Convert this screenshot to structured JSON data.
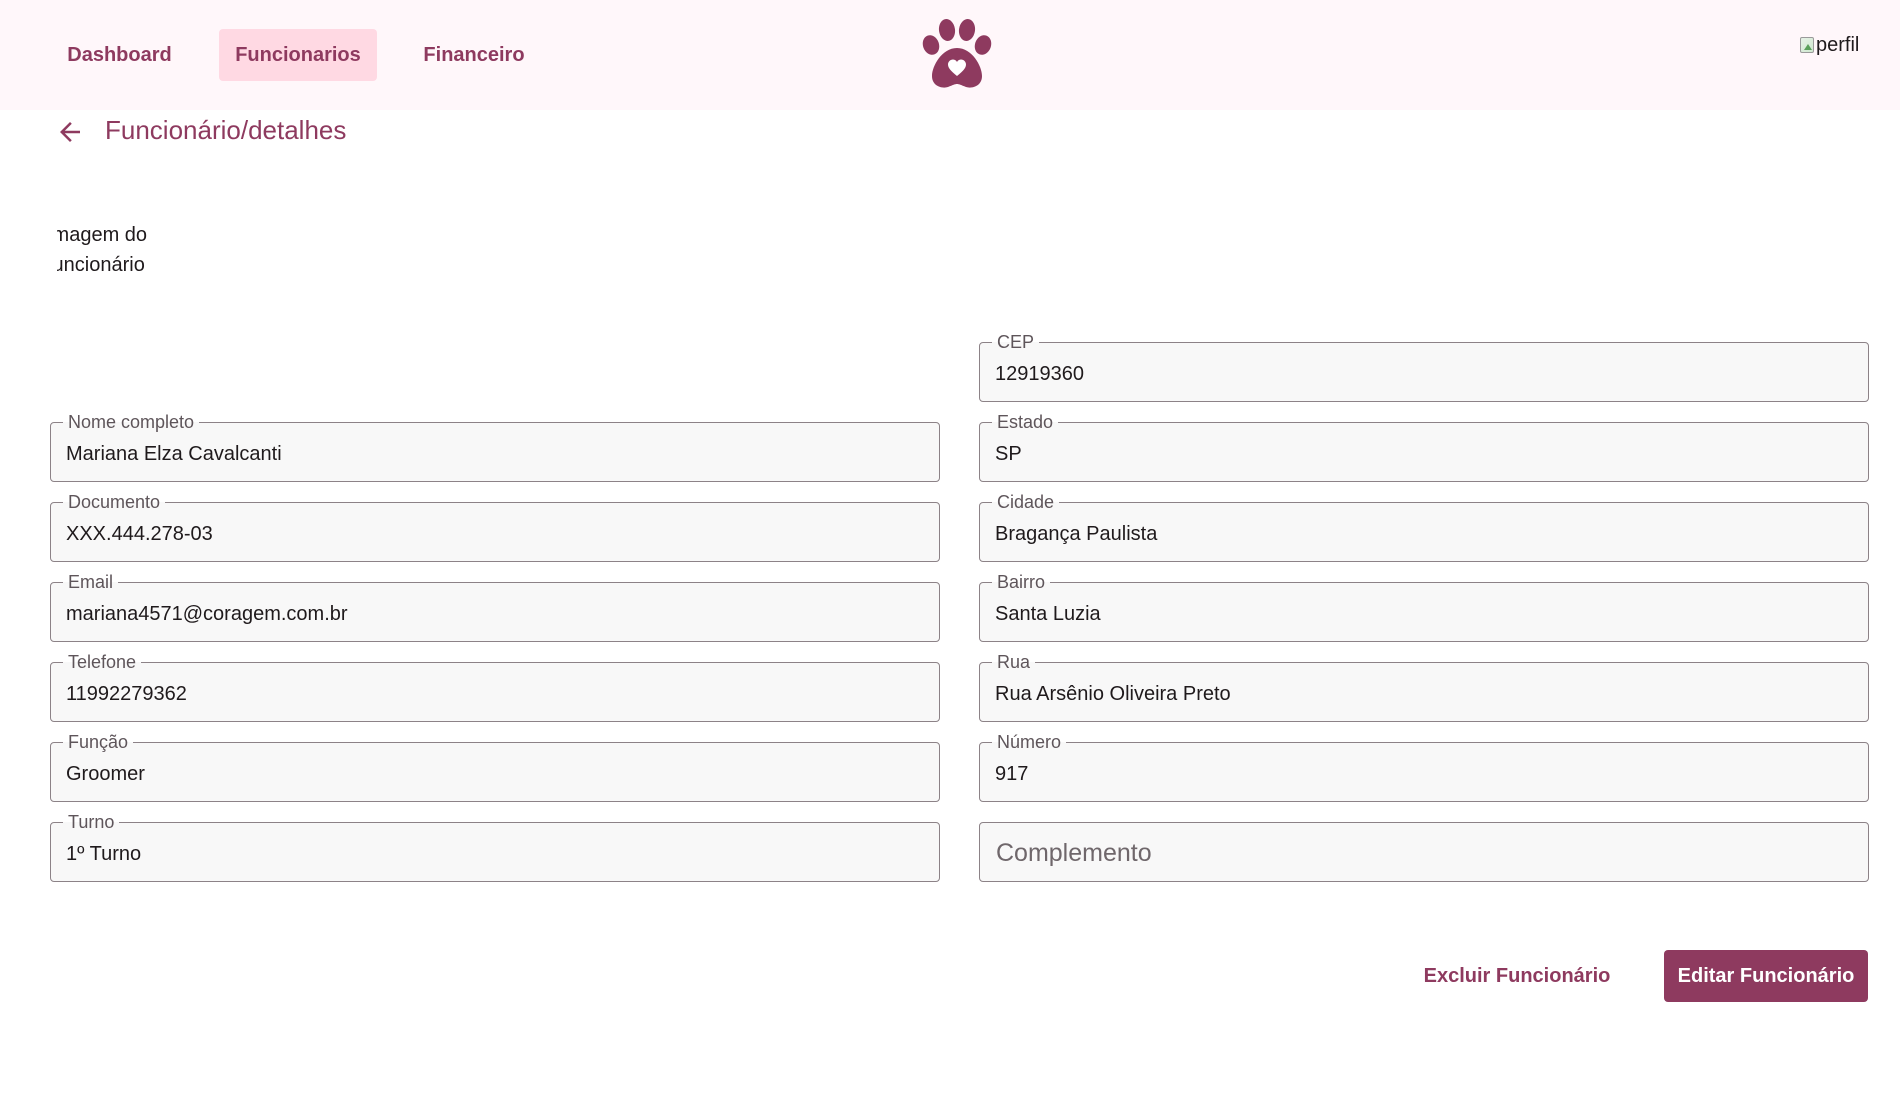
{
  "nav": {
    "items": [
      {
        "label": "Dashboard"
      },
      {
        "label": "Funcionarios"
      },
      {
        "label": "Financeiro"
      }
    ],
    "logo_icon": "paw-heart-icon",
    "profile_alt": "perfil"
  },
  "header": {
    "back_icon": "arrow-left-icon",
    "title": "Funcionário/detalhes"
  },
  "employee_image_alt": "Imagem do funcionário",
  "form": {
    "left": {
      "nome": {
        "label": "Nome completo",
        "value": "Mariana Elza Cavalcanti"
      },
      "documento": {
        "label": "Documento",
        "value": "XXX.444.278-03"
      },
      "email": {
        "label": "Email",
        "value": "mariana4571@coragem.com.br"
      },
      "telefone": {
        "label": "Telefone",
        "value": "11992279362"
      },
      "funcao": {
        "label": "Função",
        "value": "Groomer"
      },
      "turno": {
        "label": "Turno",
        "value": "1º Turno"
      }
    },
    "right": {
      "cep": {
        "label": "CEP",
        "value": "12919360"
      },
      "estado": {
        "label": "Estado",
        "value": "SP"
      },
      "cidade": {
        "label": "Cidade",
        "value": "Bragança Paulista"
      },
      "bairro": {
        "label": "Bairro",
        "value": "Santa Luzia"
      },
      "rua": {
        "label": "Rua",
        "value": "Rua Arsênio Oliveira Preto"
      },
      "numero": {
        "label": "Número",
        "value": "917"
      },
      "complemento": {
        "placeholder": "Complemento",
        "value": ""
      }
    }
  },
  "actions": {
    "delete_label": "Excluir Funcionário",
    "edit_label": "Editar Funcionário"
  },
  "colors": {
    "primary": "#8e3a5f",
    "nav_active_bg": "#ffd9e3",
    "topbar_bg": "#fff7fa"
  }
}
